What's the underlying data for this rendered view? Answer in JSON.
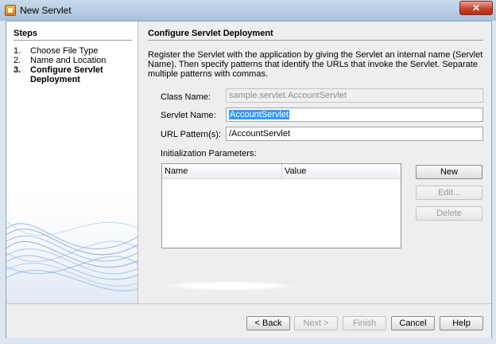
{
  "window": {
    "title": "New Servlet",
    "close_glyph": "✕"
  },
  "steps": {
    "title": "Steps",
    "items": [
      {
        "num": "1.",
        "label": "Choose File Type",
        "current": false
      },
      {
        "num": "2.",
        "label": "Name and Location",
        "current": false
      },
      {
        "num": "3.",
        "label": "Configure Servlet Deployment",
        "current": true
      }
    ]
  },
  "panel": {
    "title": "Configure Servlet Deployment",
    "description": "Register the Servlet with the application by giving the Servlet an internal name (Servlet Name). Then specify patterns that identify the URLs that invoke the Servlet. Separate multiple patterns with commas.",
    "class_name_label": "Class Name:",
    "class_name_value": "sample.servlet.AccountServlet",
    "servlet_name_label": "Servlet Name:",
    "servlet_name_value": "AccountServlet",
    "url_pattern_label": "URL Pattern(s):",
    "url_pattern_value": "/AccountServlet",
    "init_params_label": "Initialization Parameters:",
    "table": {
      "columns": [
        "Name",
        "Value"
      ],
      "rows": []
    },
    "buttons": {
      "new": "New",
      "edit": "Edit...",
      "delete": "Delete"
    }
  },
  "footer": {
    "back": "< Back",
    "next": "Next >",
    "finish": "Finish",
    "cancel": "Cancel",
    "help": "Help"
  },
  "icons": {
    "app": "servlet-app-icon",
    "close": "close-icon"
  },
  "colors": {
    "selection": "#3399ff",
    "close_button": "#c7432d",
    "title_bar": "#b9cde4"
  }
}
